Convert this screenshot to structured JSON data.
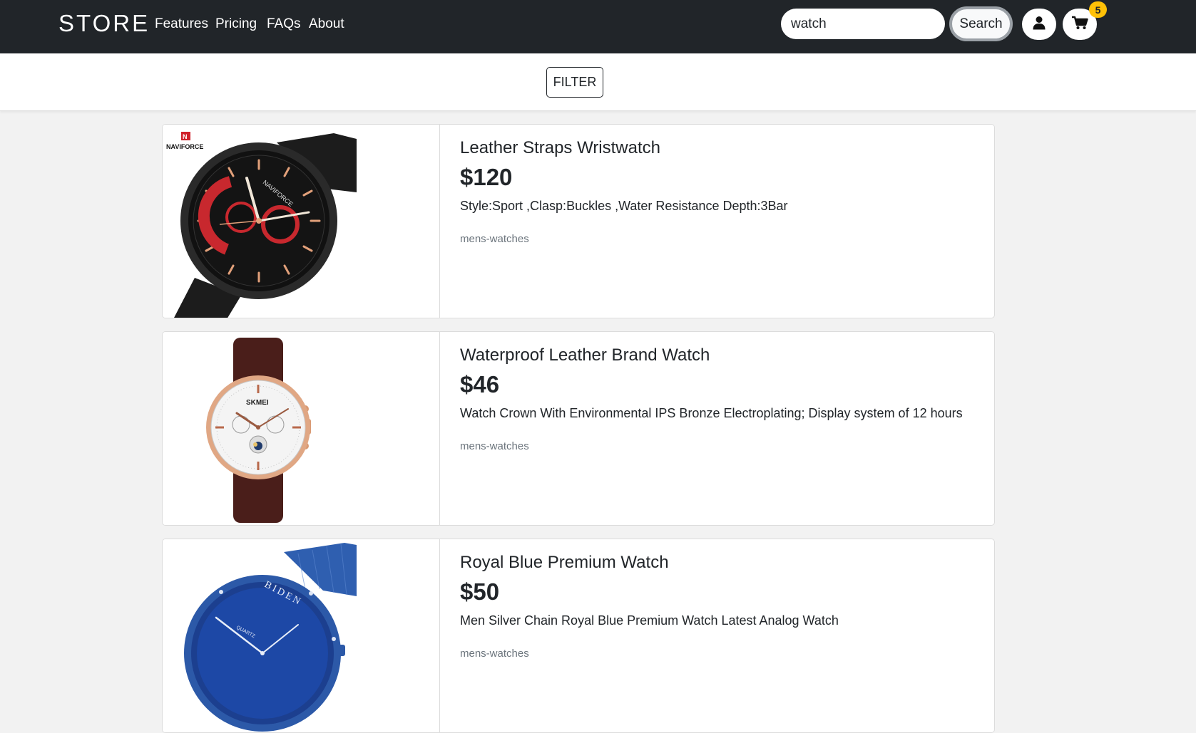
{
  "navbar": {
    "brand": "STORE",
    "links": [
      "Features",
      "Pricing",
      "FAQs",
      "About"
    ],
    "search": {
      "value": "watch",
      "button_label": "Search"
    },
    "user_icon": "user-icon",
    "cart_icon": "cart-icon",
    "cart_count": "5",
    "colors": {
      "background": "#212529",
      "badge": "#ffc107"
    }
  },
  "filter": {
    "label": "FILTER"
  },
  "products": [
    {
      "title": "Leather Straps Wristwatch",
      "price": "$120",
      "description": "Style:Sport ,Clasp:Buckles ,Water Resistance Depth:3Bar",
      "category": "mens-watches",
      "brand_mark": "NAVIFORCE",
      "dial_brand": "NAVIFORCE",
      "image_icon": "black-red-chronograph-watch-image"
    },
    {
      "title": "Waterproof Leather Brand Watch",
      "price": "$46",
      "description": "Watch Crown With Environmental IPS Bronze Electroplating; Display system of 12 hours",
      "category": "mens-watches",
      "dial_brand": "SKMEI",
      "image_icon": "rose-gold-leather-watch-image"
    },
    {
      "title": "Royal Blue Premium Watch",
      "price": "$50",
      "description": "Men Silver Chain Royal Blue Premium Watch Latest Analog Watch",
      "category": "mens-watches",
      "dial_brand": "BIDEN",
      "dial_sub": "QUARTZ",
      "image_icon": "royal-blue-mesh-watch-image"
    }
  ]
}
